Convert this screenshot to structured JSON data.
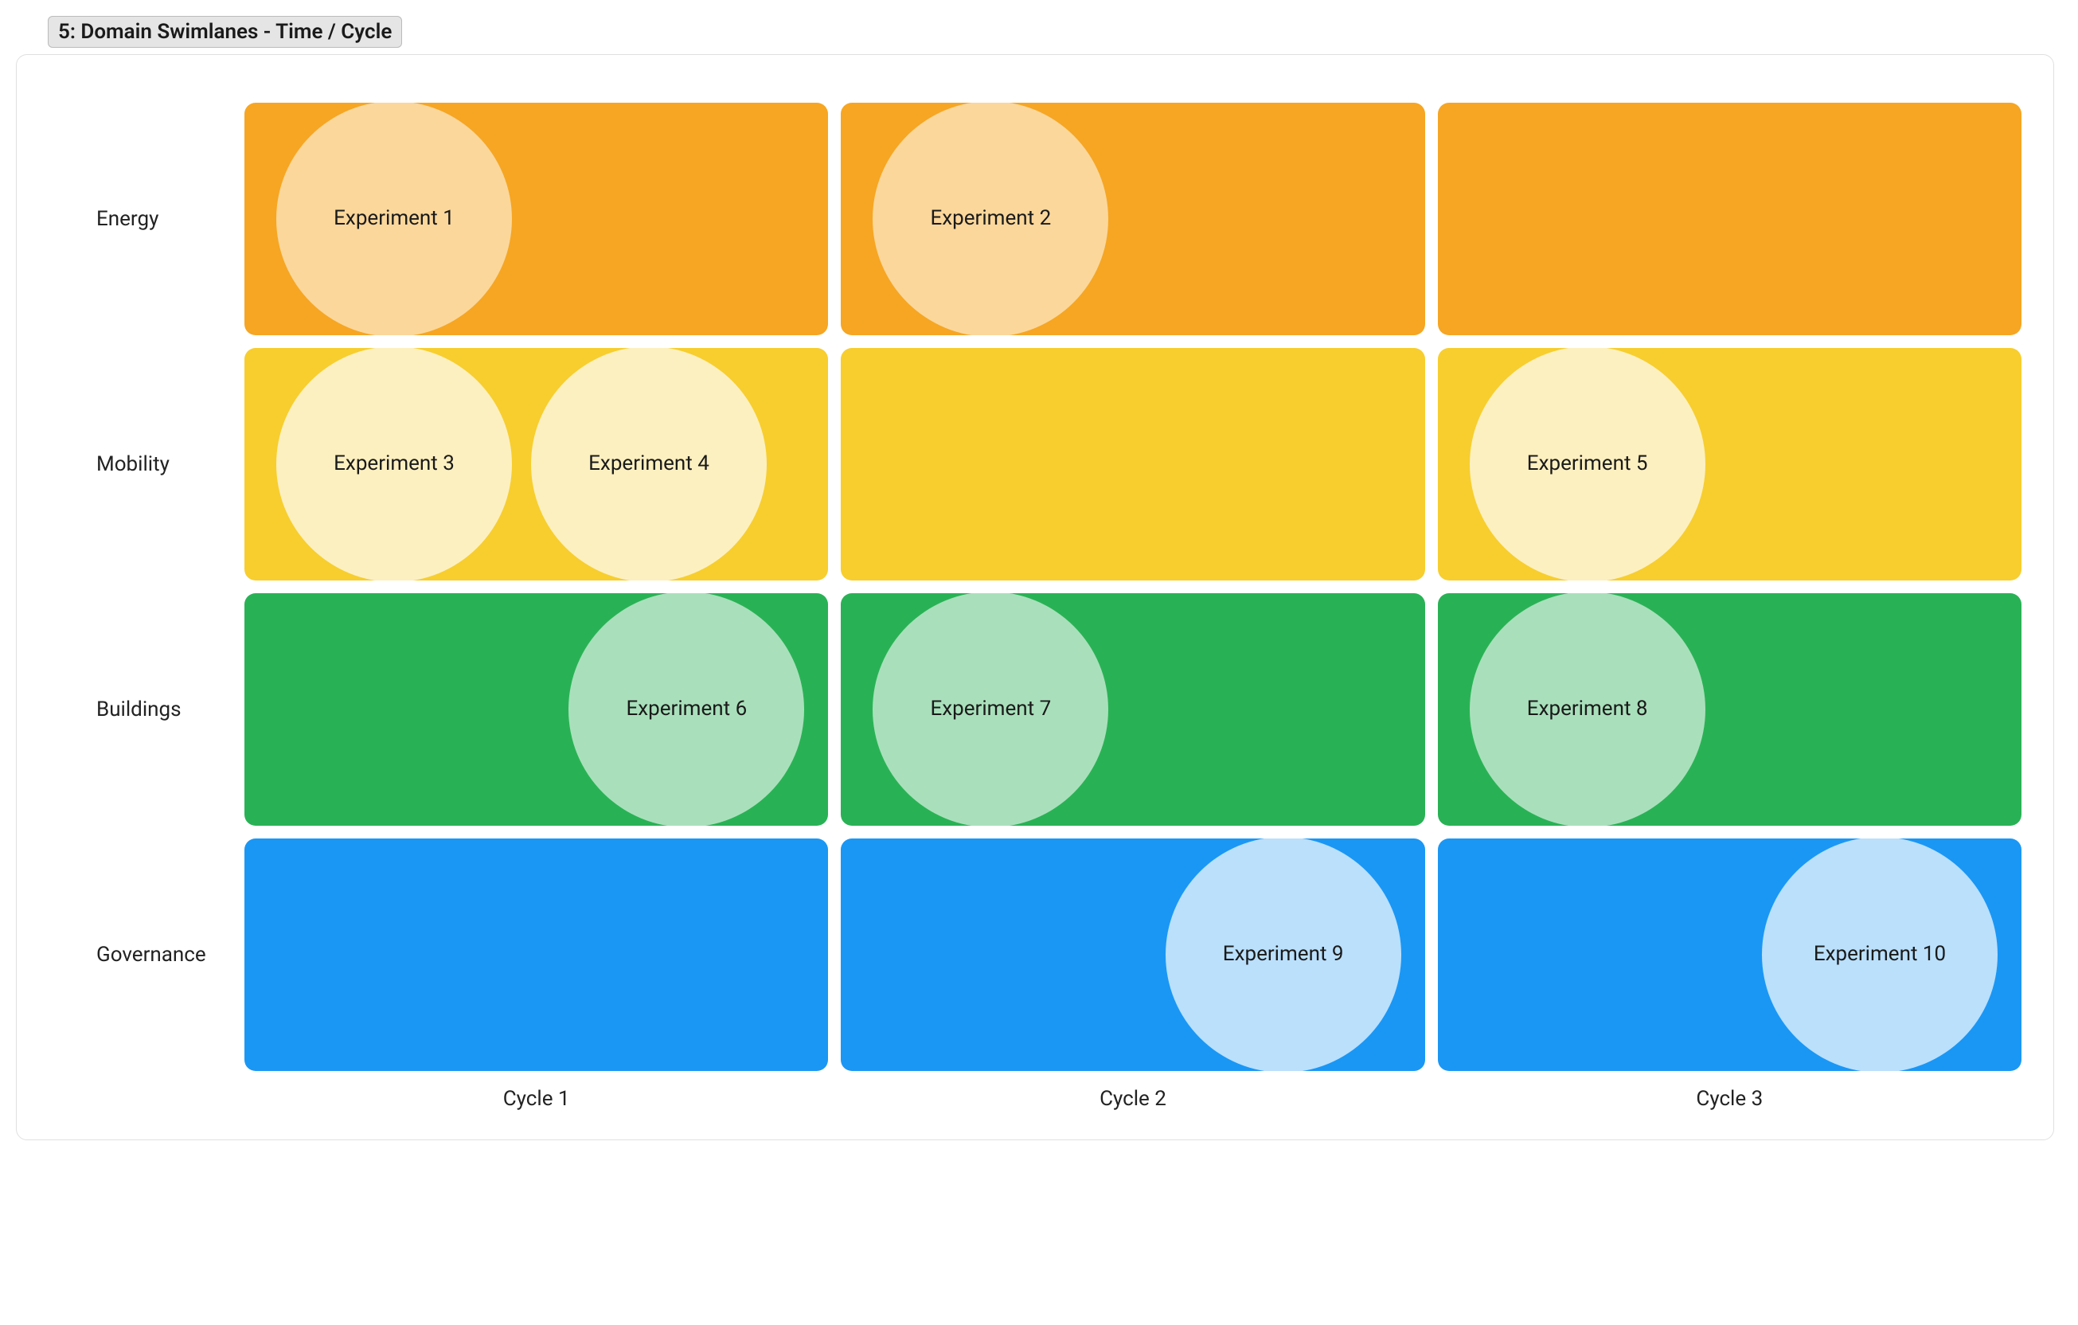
{
  "title": "5: Domain Swimlanes - Time / Cycle",
  "rows": [
    {
      "id": "energy",
      "label": "Energy"
    },
    {
      "id": "mobility",
      "label": "Mobility"
    },
    {
      "id": "buildings",
      "label": "Buildings"
    },
    {
      "id": "governance",
      "label": "Governance"
    }
  ],
  "cycles": [
    "Cycle 1",
    "Cycle 2",
    "Cycle 3"
  ],
  "experiments": [
    {
      "id": 1,
      "label": "Experiment 1",
      "row": "energy",
      "cycle": 0,
      "pos": "left"
    },
    {
      "id": 2,
      "label": "Experiment 2",
      "row": "energy",
      "cycle": 1,
      "pos": "left"
    },
    {
      "id": 3,
      "label": "Experiment 3",
      "row": "mobility",
      "cycle": 0,
      "pos": "left"
    },
    {
      "id": 4,
      "label": "Experiment 4",
      "row": "mobility",
      "cycle": 0,
      "pos": "left2"
    },
    {
      "id": 5,
      "label": "Experiment 5",
      "row": "mobility",
      "cycle": 2,
      "pos": "left"
    },
    {
      "id": 6,
      "label": "Experiment 6",
      "row": "buildings",
      "cycle": 0,
      "pos": "right"
    },
    {
      "id": 7,
      "label": "Experiment 7",
      "row": "buildings",
      "cycle": 1,
      "pos": "left"
    },
    {
      "id": 8,
      "label": "Experiment 8",
      "row": "buildings",
      "cycle": 2,
      "pos": "left"
    },
    {
      "id": 9,
      "label": "Experiment 9",
      "row": "governance",
      "cycle": 1,
      "pos": "right"
    },
    {
      "id": 10,
      "label": "Experiment 10",
      "row": "governance",
      "cycle": 2,
      "pos": "right"
    }
  ],
  "colors": {
    "energy": "#f6a623",
    "mobility": "#f7ce2e",
    "buildings": "#29b255",
    "governance": "#1a97f5"
  },
  "chart_data": {
    "type": "table",
    "title": "Domain Swimlanes - Time / Cycle",
    "rows": [
      "Energy",
      "Mobility",
      "Buildings",
      "Governance"
    ],
    "columns": [
      "Cycle 1",
      "Cycle 2",
      "Cycle 3"
    ],
    "cells": [
      [
        [
          "Experiment 1"
        ],
        [
          "Experiment 2"
        ],
        []
      ],
      [
        [
          "Experiment 3",
          "Experiment 4"
        ],
        [],
        [
          "Experiment 5"
        ]
      ],
      [
        [
          "Experiment 6"
        ],
        [
          "Experiment 7"
        ],
        [
          "Experiment 8"
        ]
      ],
      [
        [],
        [
          "Experiment 9"
        ],
        [
          "Experiment 10"
        ]
      ]
    ]
  }
}
